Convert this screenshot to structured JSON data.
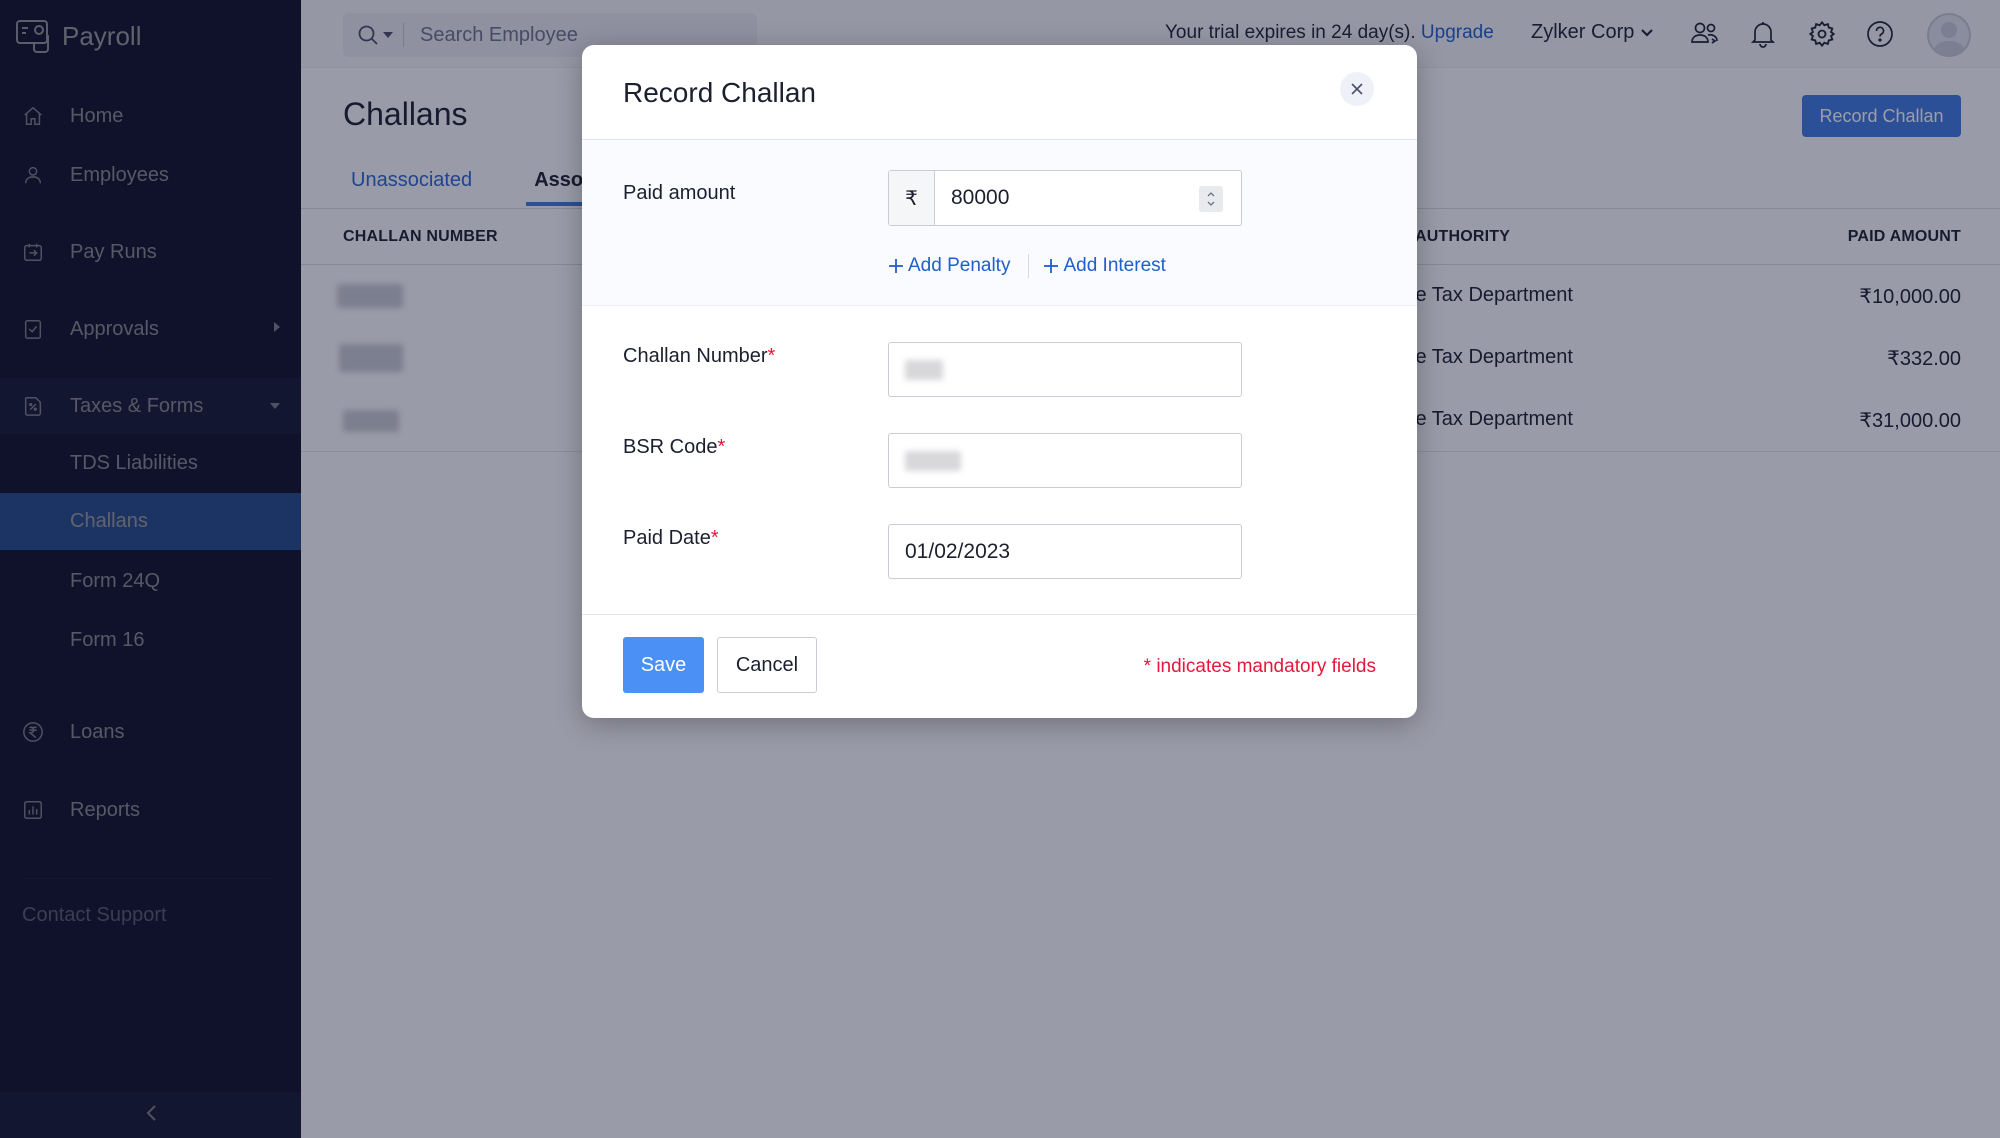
{
  "app": {
    "name": "Payroll"
  },
  "sidebar": {
    "items": [
      {
        "label": "Home",
        "icon": "home-icon"
      },
      {
        "label": "Employees",
        "icon": "user-icon"
      },
      {
        "label": "Pay Runs",
        "icon": "pay-runs-icon"
      },
      {
        "label": "Approvals",
        "icon": "approvals-icon",
        "has_submenu": true
      },
      {
        "label": "Taxes & Forms",
        "icon": "taxes-icon",
        "expanded": true
      }
    ],
    "sub_items": [
      {
        "label": "TDS Liabilities"
      },
      {
        "label": "Challans",
        "active": true
      },
      {
        "label": "Form 24Q"
      },
      {
        "label": "Form 16"
      }
    ],
    "lower_items": [
      {
        "label": "Loans",
        "icon": "rupee-circle-icon"
      },
      {
        "label": "Reports",
        "icon": "reports-icon"
      }
    ],
    "contact_support": "Contact Support"
  },
  "header": {
    "search_placeholder": "Search Employee",
    "trial_text": "Your trial expires in 24 day(s).",
    "upgrade_label": "Upgrade",
    "org_name": "Zylker Corp"
  },
  "page": {
    "title": "Challans",
    "record_button": "Record Challan",
    "tabs": [
      {
        "label": "Unassociated",
        "active": false
      },
      {
        "label": "Associated",
        "active": true
      }
    ],
    "table": {
      "columns": [
        "CHALLAN NUMBER",
        "AUTHORITY",
        "PAID AMOUNT"
      ],
      "rows": [
        {
          "challan_number": "[redacted]",
          "authority": "Income Tax Department",
          "paid_amount": "₹10,000.00"
        },
        {
          "challan_number": "[redacted]",
          "authority": "Income Tax Department",
          "paid_amount": "₹332.00"
        },
        {
          "challan_number": "[redacted]",
          "authority": "Income Tax Department",
          "paid_amount": "₹31,000.00"
        }
      ]
    }
  },
  "modal": {
    "title": "Record Challan",
    "paid_amount_label": "Paid amount",
    "currency_symbol": "₹",
    "paid_amount_value": "80000",
    "add_penalty": "Add Penalty",
    "add_interest": "Add Interest",
    "challan_number_label": "Challan Number",
    "challan_number_value": "[redacted]",
    "bsr_code_label": "BSR Code",
    "bsr_code_value": "[redacted]",
    "paid_date_label": "Paid Date",
    "paid_date_value": "01/02/2023",
    "required_marker": "*",
    "save_label": "Save",
    "cancel_label": "Cancel",
    "mandatory_note": "* indicates mandatory fields"
  },
  "colors": {
    "sidebar_bg": "#1e2250",
    "active_nav": "#3f7de3",
    "primary_button": "#3d7be0",
    "save_button": "#4a90f5",
    "link": "#1f5fc9",
    "required": "#e5173a"
  }
}
